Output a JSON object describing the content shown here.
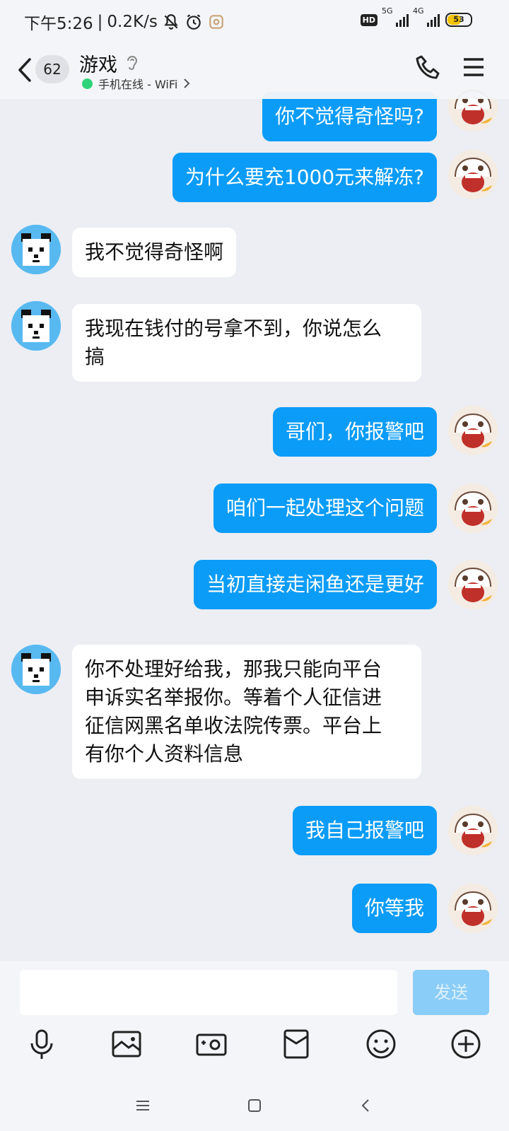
{
  "status_bar": {
    "time": "下午5:26",
    "net_speed": "0.2K/s",
    "hd_badge": "HD",
    "sim1_type": "5G",
    "sim2_type": "4G",
    "battery": "53"
  },
  "header": {
    "unread_count": "62",
    "title": "游戏",
    "status_text": "手机在线 - WiFi"
  },
  "messages": [
    {
      "side": "right",
      "text": "你不觉得奇怪吗?"
    },
    {
      "side": "right",
      "text": "为什么要充1000元来解冻?"
    },
    {
      "side": "left",
      "text": "我不觉得奇怪啊"
    },
    {
      "side": "left",
      "text": "我现在钱付的号拿不到，你说怎么\n搞"
    },
    {
      "side": "right",
      "text": "哥们，你报警吧"
    },
    {
      "side": "right",
      "text": "咱们一起处理这个问题"
    },
    {
      "side": "right",
      "text": "当初直接走闲鱼还是更好"
    },
    {
      "side": "left",
      "text": "你不处理好给我，那我只能向平台\n申诉实名举报你。等着个人征信进\n征信网黑名单收法院传票。平台上\n有你个人资料信息"
    },
    {
      "side": "right",
      "text": "我自己报警吧"
    },
    {
      "side": "right",
      "text": "你等我"
    }
  ],
  "composer": {
    "input_value": "",
    "send_label": "发送"
  },
  "toolbar": {
    "items": [
      "microphone-icon",
      "image-icon",
      "camera-icon",
      "red-packet-icon",
      "emoji-icon",
      "plus-icon"
    ]
  },
  "colors": {
    "outgoing_bubble": "#0b9cf7",
    "incoming_bubble": "#ffffff",
    "online_dot": "#2fd37a",
    "send_button_disabled": "#8bcdf9"
  }
}
